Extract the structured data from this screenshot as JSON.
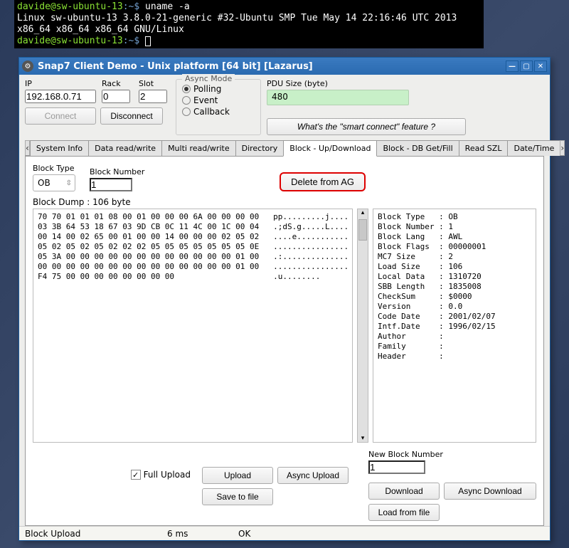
{
  "terminal": {
    "line1_prompt": "davide@sw-ubuntu-13",
    "line1_path": ":~$ ",
    "line1_cmd": "uname -a",
    "line2": "Linux sw-ubuntu-13 3.8.0-21-generic #32-Ubuntu SMP Tue May 14 22:16:46 UTC 2013",
    "line3": "x86_64 x86_64 x86_64 GNU/Linux",
    "line4_prompt": "davide@sw-ubuntu-13",
    "line4_path": ":~$ "
  },
  "window": {
    "title": "Snap7 Client Demo - Unix platform [64 bit] [Lazarus]",
    "ip_label": "IP",
    "ip_value": "192.168.0.71",
    "rack_label": "Rack",
    "rack_value": "0",
    "slot_label": "Slot",
    "slot_value": "2",
    "connect_label": "Connect",
    "disconnect_label": "Disconnect",
    "async_legend": "Async Mode",
    "async_polling": "Polling",
    "async_event": "Event",
    "async_callback": "Callback",
    "pdu_label": "PDU Size (byte)",
    "pdu_value": "480",
    "smart_label": "What's the \"smart connect\" feature ?"
  },
  "tabs": {
    "left_arrow": "‹",
    "right_arrow": "›",
    "items": [
      "System Info",
      "Data read/write",
      "Multi read/write",
      "Directory",
      "Block - Up/Download",
      "Block - DB Get/Fill",
      "Read SZL",
      "Date/Time"
    ],
    "active": "Block - Up/Download"
  },
  "block": {
    "type_label": "Block Type",
    "type_value": "OB",
    "number_label": "Block Number",
    "number_value": "1",
    "delete_label": "Delete from AG",
    "dump_label": "Block Dump : 106 byte",
    "hex": "70 70 01 01 01 08 00 01 00 00 00 6A 00 00 00 00   pp.........j....\n03 3B 64 53 18 67 03 9D CB 0C 11 4C 00 1C 00 04   .;dS.g.....L....\n00 14 00 02 65 00 01 00 00 14 00 00 00 02 05 02   ....e...........\n05 02 05 02 05 02 02 02 05 05 05 05 05 05 05 0E   ................\n05 3A 00 00 00 00 00 00 00 00 00 00 00 00 01 00   .:..............\n00 00 00 00 00 00 00 00 00 00 00 00 00 00 01 00   ................\nF4 75 00 00 00 00 00 00 00 00                     .u........",
    "info": "Block Type   : OB\nBlock Number : 1\nBlock Lang   : AWL\nBlock Flags  : 00000001\nMC7 Size     : 2\nLoad Size    : 106\nLocal Data   : 1310720\nSBB Length   : 1835008\nCheckSum     : $0000\nVersion      : 0.0\nCode Date    : 2001/02/07\nIntf.Date    : 1996/02/15\nAuthor       :\nFamily       :\nHeader       :",
    "full_upload_label": "Full Upload",
    "full_upload_checked": "✓",
    "upload_label": "Upload",
    "async_upload_label": "Async Upload",
    "save_label": "Save to file",
    "new_block_label": "New Block Number",
    "new_block_value": "1",
    "download_label": "Download",
    "async_download_label": "Async Download",
    "load_label": "Load from file"
  },
  "status": {
    "col1": "Block Upload",
    "col2": "6 ms",
    "col3": "OK"
  }
}
